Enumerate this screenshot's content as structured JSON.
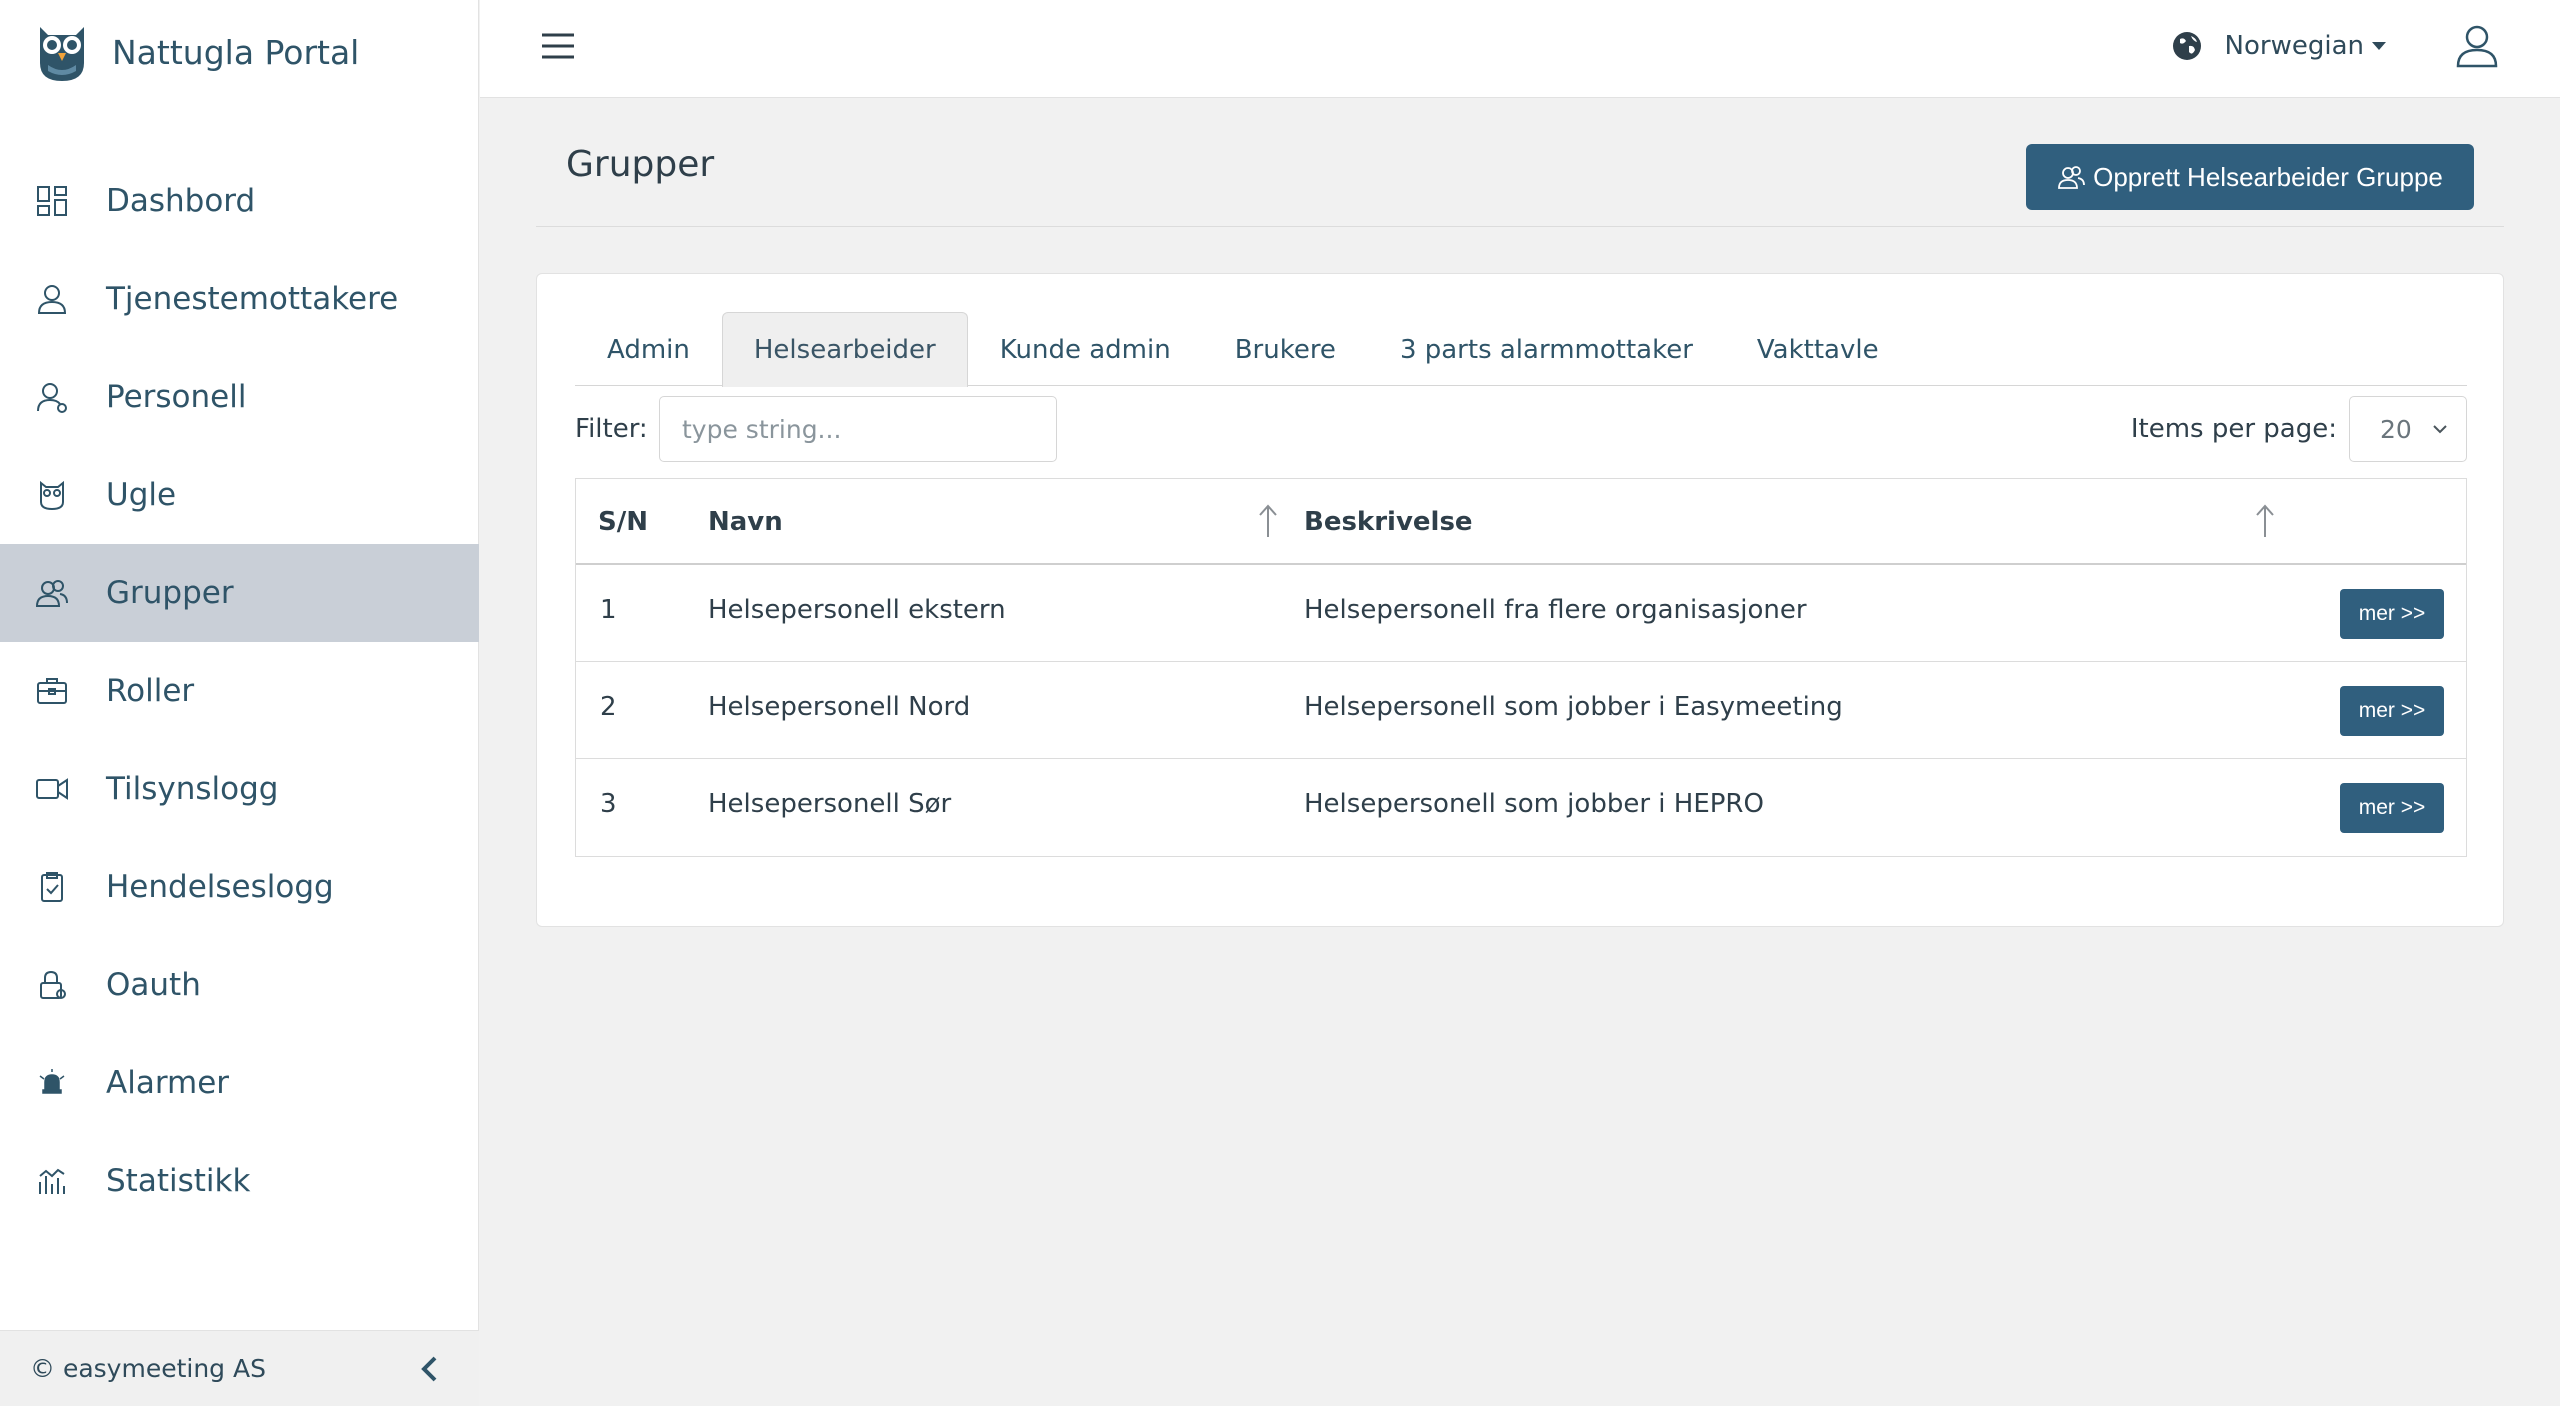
{
  "app": {
    "title": "Nattugla Portal"
  },
  "sidebar": {
    "items": [
      {
        "label": "Dashbord",
        "icon": "dashboard-icon",
        "active": false
      },
      {
        "label": "Tjenestemottakere",
        "icon": "person-icon",
        "active": false
      },
      {
        "label": "Personell",
        "icon": "staff-icon",
        "active": false
      },
      {
        "label": "Ugle",
        "icon": "owl-icon",
        "active": false
      },
      {
        "label": "Grupper",
        "icon": "group-icon",
        "active": true
      },
      {
        "label": "Roller",
        "icon": "briefcase-icon",
        "active": false
      },
      {
        "label": "Tilsynslogg",
        "icon": "video-camera-icon",
        "active": false
      },
      {
        "label": "Hendelseslogg",
        "icon": "clipboard-icon",
        "active": false
      },
      {
        "label": "Oauth",
        "icon": "lock-icon",
        "active": false
      },
      {
        "label": "Alarmer",
        "icon": "alarm-icon",
        "active": false
      },
      {
        "label": "Statistikk",
        "icon": "chart-icon",
        "active": false
      }
    ],
    "footer": "© easymeeting AS"
  },
  "topbar": {
    "language": "Norwegian"
  },
  "page": {
    "title": "Grupper",
    "create_button": "Opprett Helsearbeider Gruppe"
  },
  "tabs": [
    {
      "label": "Admin",
      "active": false
    },
    {
      "label": "Helsearbeider",
      "active": true
    },
    {
      "label": "Kunde admin",
      "active": false
    },
    {
      "label": "Brukere",
      "active": false
    },
    {
      "label": "3 parts alarmmottaker",
      "active": false
    },
    {
      "label": "Vakttavle",
      "active": false
    }
  ],
  "filter": {
    "label": "Filter:",
    "placeholder": "type string...",
    "value": ""
  },
  "pagination": {
    "label": "Items per page:",
    "value": "20"
  },
  "table": {
    "headers": {
      "sn": "S/N",
      "name": "Navn",
      "description": "Beskrivelse"
    },
    "rows": [
      {
        "sn": "1",
        "name": "Helsepersonell ekstern",
        "description": "Helsepersonell fra flere organisasjoner",
        "action": "mer >>"
      },
      {
        "sn": "2",
        "name": "Helsepersonell Nord",
        "description": "Helsepersonell som jobber i Easymeeting",
        "action": "mer >>"
      },
      {
        "sn": "3",
        "name": "Helsepersonell Sør",
        "description": "Helsepersonell som jobber i HEPRO",
        "action": "mer >>"
      }
    ]
  },
  "colors": {
    "primary": "#305f7e",
    "sidebar_active": "#c9cfd7",
    "text": "#2f5468"
  }
}
